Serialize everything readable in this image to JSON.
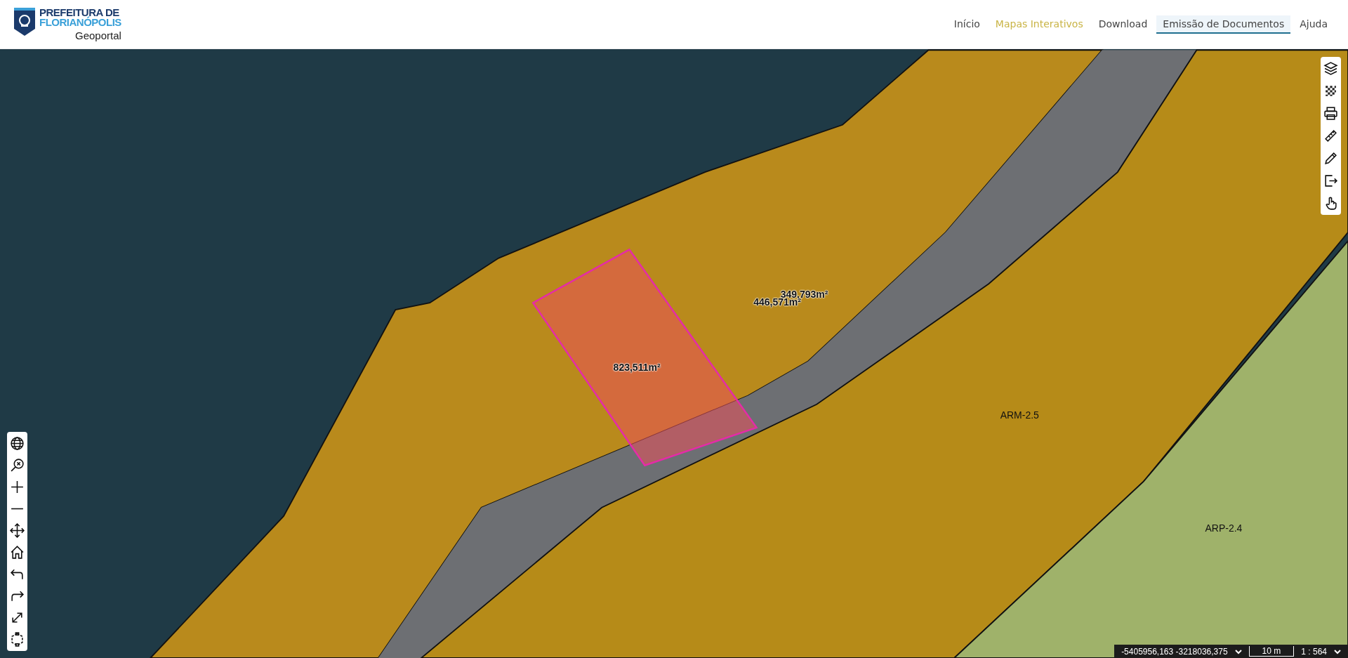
{
  "header": {
    "logo_line1": "PREFEITURA DE",
    "logo_line2": "FLORIANÓPOLIS",
    "subtitle": "Geoportal"
  },
  "nav": [
    {
      "label": "Início",
      "selected": false,
      "highlighted": false
    },
    {
      "label": "Mapas Interativos",
      "selected": false,
      "highlighted": true
    },
    {
      "label": "Download",
      "selected": false,
      "highlighted": false
    },
    {
      "label": "Emissão de Documentos",
      "selected": true,
      "highlighted": false
    },
    {
      "label": "Ajuda",
      "selected": false,
      "highlighted": false
    }
  ],
  "map": {
    "measurements": [
      "349,793m²",
      "446,571m²",
      "823,511m²"
    ],
    "zones": [
      "ARM-2.5",
      "ARP-2.4"
    ]
  },
  "status_bar": {
    "coordinates": "-5405956,163 -3218036,375",
    "scale_bar": "10 m",
    "scale": "1 : 564"
  }
}
